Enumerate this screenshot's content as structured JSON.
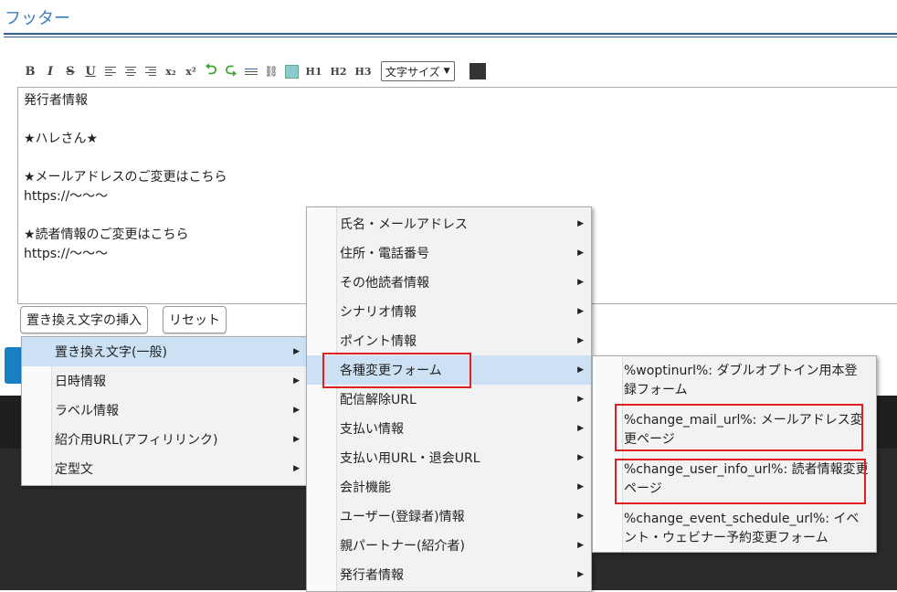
{
  "section": {
    "title": "フッター"
  },
  "toolbar": {
    "bold": "B",
    "italic": "I",
    "strike": "S",
    "underline": "U",
    "sub": "x₂",
    "sup": "x²",
    "h1": "H1",
    "h2": "H2",
    "h3": "H3",
    "font_size_select": "文字サイズ",
    "icons": [
      "align-left-icon",
      "align-center-icon",
      "align-right-icon",
      "undo-icon",
      "redo-icon",
      "hr-icon",
      "link-icon",
      "image-icon",
      "color-swatch-icon"
    ]
  },
  "editor": {
    "lines": [
      "発行者情報",
      "",
      "★ハレさん★",
      "",
      "★メールアドレスのご変更はこちら",
      "https://～～～",
      "",
      "★読者情報のご変更はこちら",
      "https://～～～"
    ]
  },
  "buttons": {
    "insert": "置き換え文字の挿入",
    "reset": "リセット"
  },
  "menu1": {
    "items": [
      "置き換え文字(一般)",
      "日時情報",
      "ラベル情報",
      "紹介用URL(アフィリリンク)",
      "定型文"
    ]
  },
  "menu2": {
    "items": [
      "氏名・メールアドレス",
      "住所・電話番号",
      "その他読者情報",
      "シナリオ情報",
      "ポイント情報",
      "各種変更フォーム",
      "配信解除URL",
      "支払い情報",
      "支払い用URL・退会URL",
      "会計機能",
      "ユーザー(登録者)情報",
      "親パートナー(紹介者)",
      "発行者情報"
    ]
  },
  "menu3": {
    "items": [
      "%woptinurl%: ダブルオプトイン用本登録フォーム",
      "%change_mail_url%: メールアドレス変更ページ",
      "%change_user_info_url%: 読者情報変更ページ",
      "%change_event_schedule_url%: イベント・ウェビナー予約変更フォーム"
    ]
  },
  "colors": {
    "accent": "#3a7cc4",
    "highlight": "#cde1f5",
    "annotation": "#e02020"
  }
}
